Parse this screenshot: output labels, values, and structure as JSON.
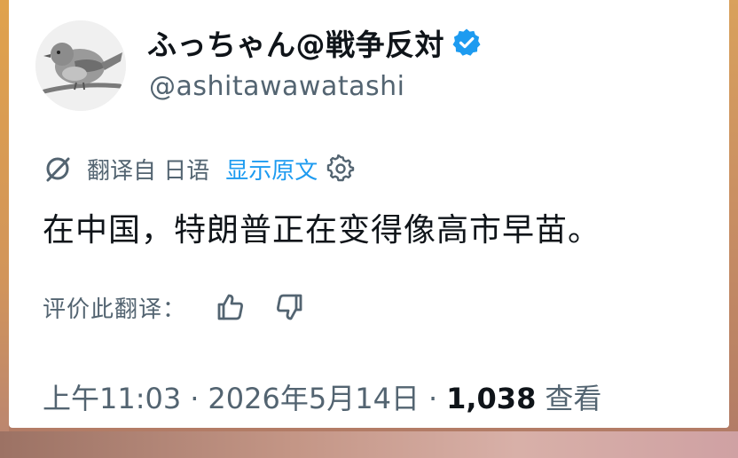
{
  "tweet": {
    "display_name": "ふっちゃん@戦争反対",
    "handle": "@ashitawawatashi",
    "verified_icon": "verified-badge-icon",
    "translation": {
      "translated_from": "翻译自 日语",
      "show_original": "显示原文",
      "settings_icon": "gear-icon"
    },
    "text": "在中国，特朗普正在变得像高市早苗。",
    "rate_label": "评价此翻译：",
    "time": "上午11:03",
    "separator": "·",
    "date": "2026年5月14日",
    "views_count": "1,038",
    "views_label": "查看"
  },
  "colors": {
    "accent": "#1d9bf0",
    "text": "#0f1419",
    "secondary": "#536471"
  }
}
